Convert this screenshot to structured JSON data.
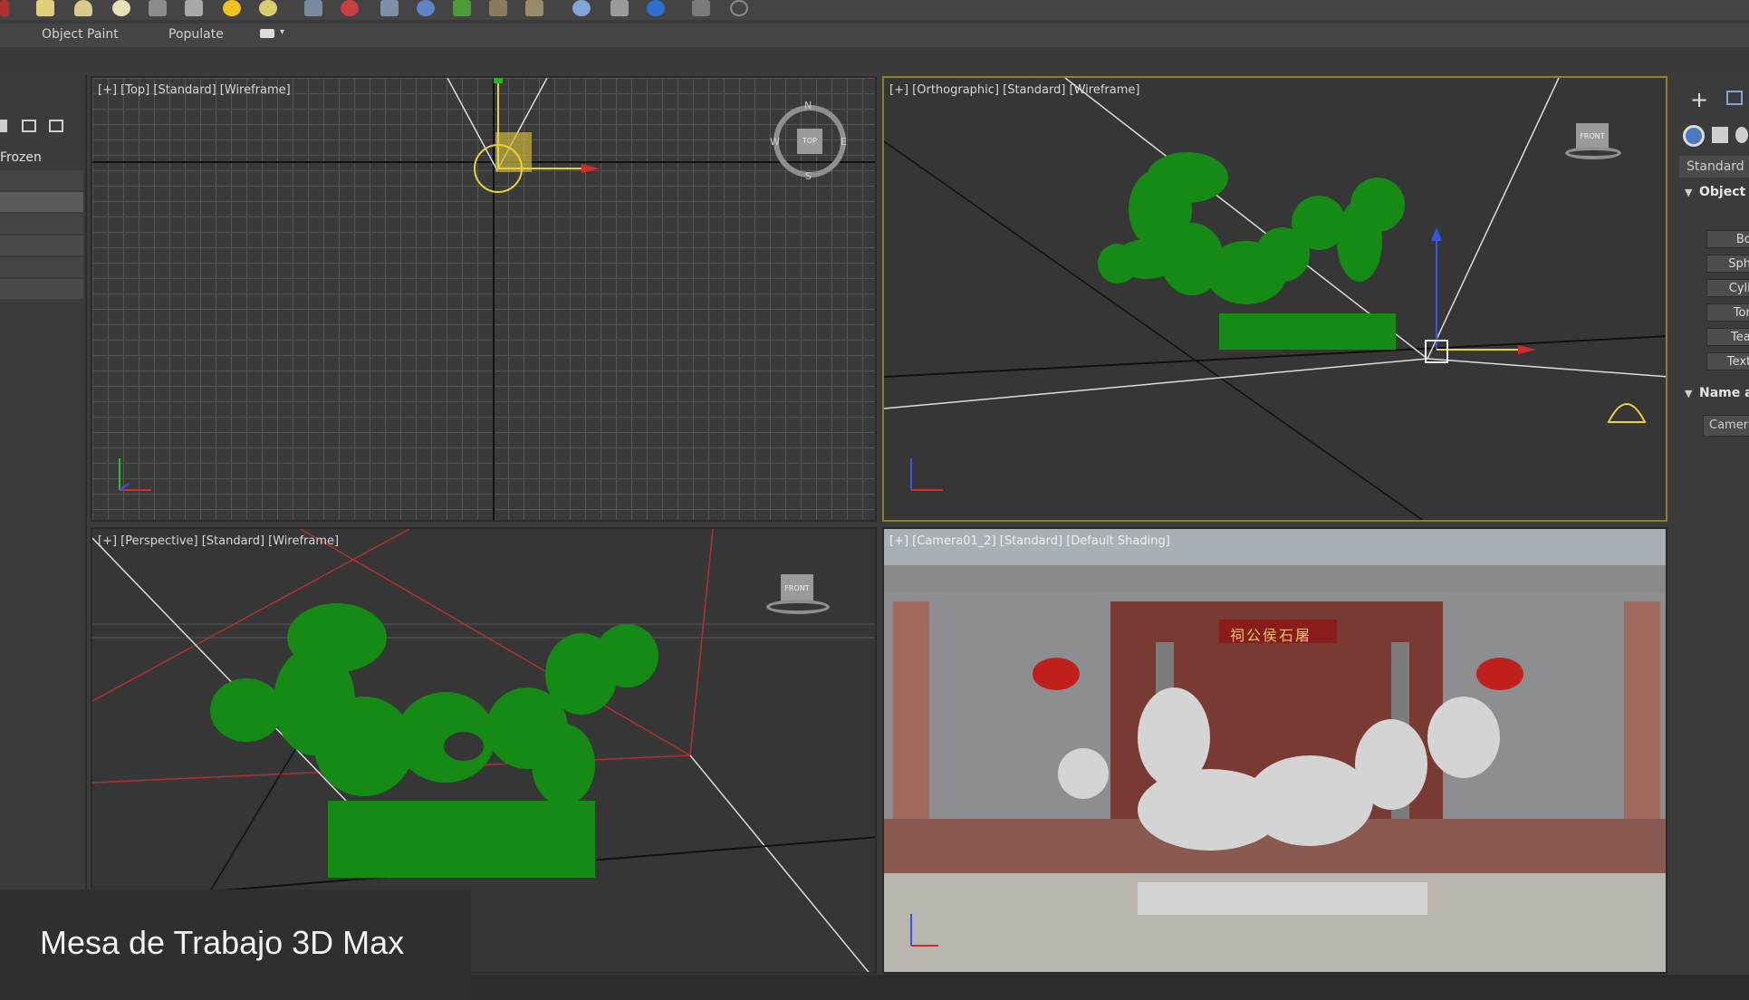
{
  "ribbon": {
    "object_paint": "Object Paint",
    "populate": "Populate"
  },
  "left_panel": {
    "frozen_label": "Frozen"
  },
  "viewports": {
    "top": {
      "label": "[+] [Top] [Standard] [Wireframe]",
      "compass": {
        "n": "N",
        "s": "S",
        "e": "E",
        "w": "W",
        "cube": "TOP"
      }
    },
    "orthographic": {
      "label": "[+] [Orthographic] [Standard] [Wireframe]",
      "cube": "FRONT"
    },
    "perspective": {
      "label": "[+] [Perspective] [Standard] [Wireframe]",
      "cube": "FRONT"
    },
    "camera": {
      "label": "[+] [Camera01_2] [Standard] [Default Shading]",
      "sign_text": "祠公侯石屠"
    }
  },
  "right_panel": {
    "dropdown": "Standard Pr",
    "object_type_header": "Object T",
    "buttons": [
      "Box",
      "Sphe",
      "Cylin",
      "Toru",
      "Teap",
      "TextP"
    ],
    "name_header": "Name a",
    "name_value": "Camera"
  },
  "caption": "Mesa de Trabajo 3D Max",
  "colors": {
    "dragon_green": "#158a15",
    "active_border": "#8f7f32",
    "panel_bg": "#3b3b3b"
  }
}
